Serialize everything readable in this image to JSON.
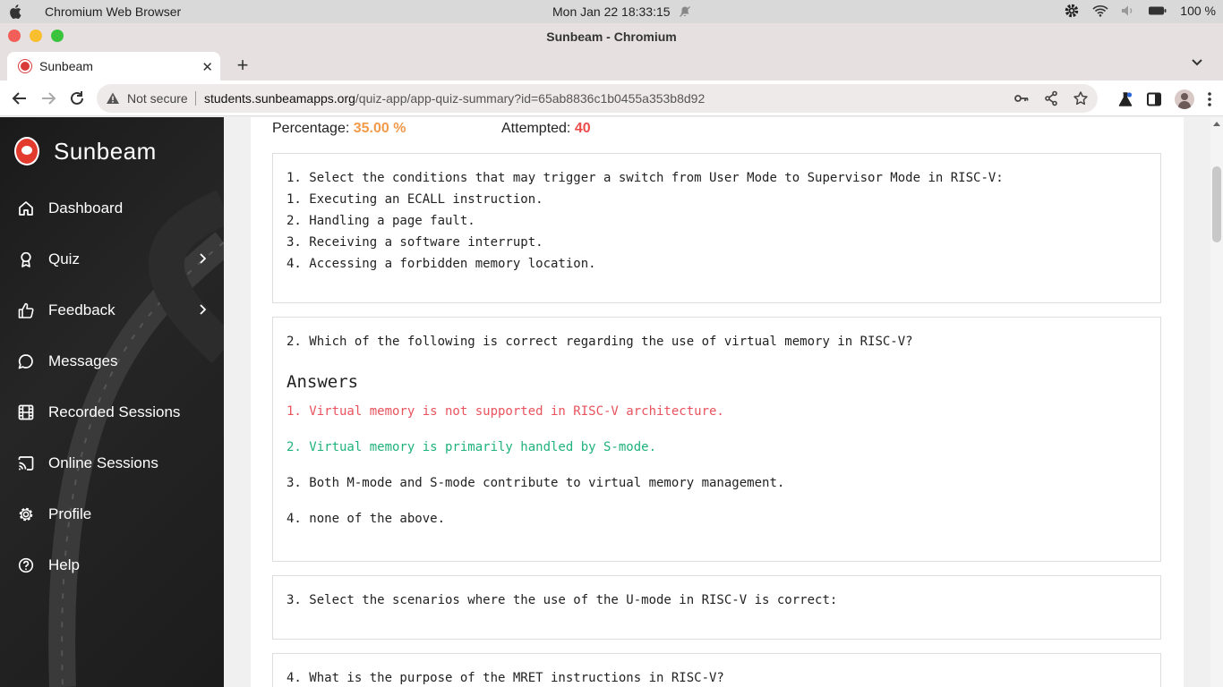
{
  "os": {
    "app_name": "Chromium Web Browser",
    "clock": "Mon Jan 22  18:33:15",
    "battery": "100 %"
  },
  "window": {
    "title": "Sunbeam - Chromium"
  },
  "tab": {
    "title": "Sunbeam"
  },
  "omnibox": {
    "security": "Not secure",
    "url_host": "students.sunbeamapps.org",
    "url_path": "/quiz-app/app-quiz-summary?id=65ab8836c1b0455a353b8d92"
  },
  "sidebar": {
    "brand": "Sunbeam",
    "items": [
      {
        "label": "Dashboard",
        "icon": "home-icon"
      },
      {
        "label": "Quiz",
        "icon": "award-icon"
      },
      {
        "label": "Feedback",
        "icon": "thumbs-up-icon"
      },
      {
        "label": "Messages",
        "icon": "chat-icon"
      },
      {
        "label": "Recorded Sessions",
        "icon": "film-icon"
      },
      {
        "label": "Online Sessions",
        "icon": "cast-icon"
      },
      {
        "label": "Profile",
        "icon": "gear-icon"
      },
      {
        "label": "Help",
        "icon": "help-icon"
      }
    ]
  },
  "summary": {
    "percentage_label": "Percentage:",
    "percentage_value": "35.00 %",
    "attempted_label": "Attempted:",
    "attempted_value": "40"
  },
  "questions": [
    {
      "text": "1. Select the conditions that may trigger a switch from User Mode to Supervisor Mode in RISC-V:",
      "lines": [
        "1. Executing an ECALL instruction.",
        "2. Handling a page fault.",
        "3. Receiving a software interrupt.",
        "4. Accessing a forbidden memory location."
      ]
    },
    {
      "text": "2. Which of the following is correct regarding the use of virtual memory in RISC-V?",
      "answers_heading": "Answers",
      "answers": [
        "1. Virtual memory is not supported in RISC-V architecture.",
        "2. Virtual memory is primarily handled by S-mode.",
        "3. Both M-mode and S-mode contribute to virtual memory management.",
        "4. none of the above."
      ],
      "colors": {
        "wrong": "#e8535e",
        "correct": "#20b27c"
      }
    },
    {
      "text": "3. Select the scenarios where the use of the U-mode in RISC-V is correct:"
    },
    {
      "text": "4. What is the purpose of the MRET instructions in RISC-V?"
    }
  ]
}
